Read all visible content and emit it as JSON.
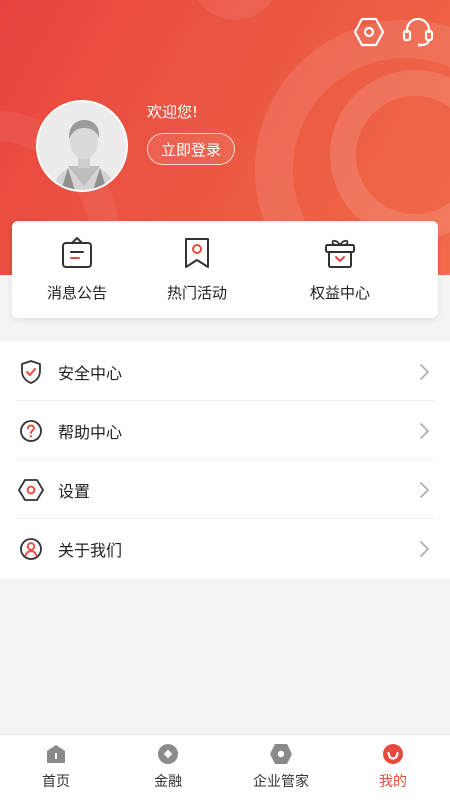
{
  "header": {
    "welcome_text": "欢迎您!",
    "login_button": "立即登录",
    "icons": {
      "settings": "settings-hexagon-icon",
      "service": "headset-icon"
    },
    "gradient_colors": [
      "#e8443f",
      "#f06a48"
    ]
  },
  "quick_links": [
    {
      "label": "消息公告",
      "icon": "announcement-board-icon"
    },
    {
      "label": "热门活动",
      "icon": "ribbon-badge-icon"
    },
    {
      "label": "权益中心",
      "icon": "gift-box-icon"
    }
  ],
  "menu": [
    {
      "label": "安全中心",
      "icon": "shield-check-icon"
    },
    {
      "label": "帮助中心",
      "icon": "question-circle-icon"
    },
    {
      "label": "设置",
      "icon": "settings-hexagon-icon"
    },
    {
      "label": "关于我们",
      "icon": "person-circle-icon"
    }
  ],
  "tabbar": {
    "items": [
      {
        "label": "首页",
        "icon": "home-icon",
        "active": false
      },
      {
        "label": "金融",
        "icon": "finance-diamond-icon",
        "active": false
      },
      {
        "label": "企业管家",
        "icon": "enterprise-hexagon-icon",
        "active": false
      },
      {
        "label": "我的",
        "icon": "smile-circle-icon",
        "active": true
      }
    ],
    "active_color": "#e84a3f"
  }
}
